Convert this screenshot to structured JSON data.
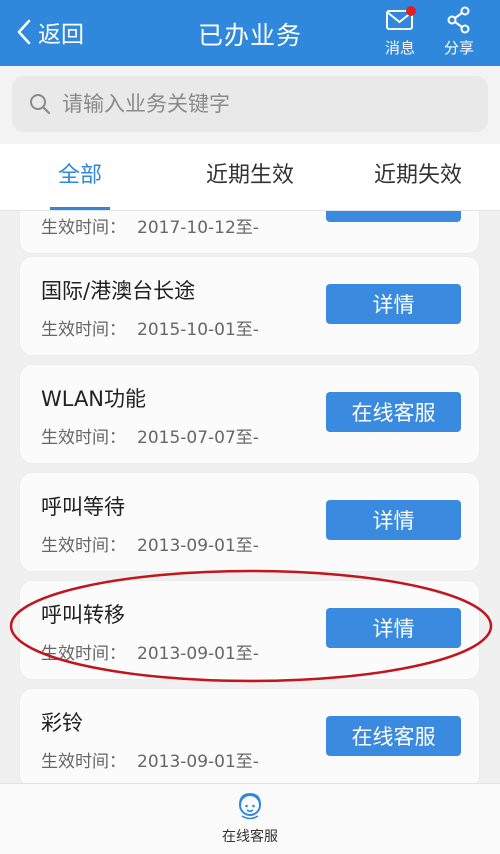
{
  "header": {
    "back_label": "返回",
    "title": "已办业务",
    "message_label": "消息",
    "share_label": "分享",
    "color": "#2f88db"
  },
  "search": {
    "placeholder": "请输入业务关键字"
  },
  "tabs": [
    {
      "label": "全部",
      "active": true
    },
    {
      "label": "近期生效",
      "active": false
    },
    {
      "label": "近期失效",
      "active": false
    }
  ],
  "date_prefix": "生效时间：",
  "items": [
    {
      "name": "",
      "date": "2017-10-12至-",
      "button": ""
    },
    {
      "name": "国际/港澳台长途",
      "date": "2015-10-01至-",
      "button": "详情"
    },
    {
      "name": "WLAN功能",
      "date": "2015-07-07至-",
      "button": "在线客服"
    },
    {
      "name": "呼叫等待",
      "date": "2013-09-01至-",
      "button": "详情"
    },
    {
      "name": "呼叫转移",
      "date": "2013-09-01至-",
      "button": "详情"
    },
    {
      "name": "彩铃",
      "date": "2013-09-01至-",
      "button": "在线客服"
    }
  ],
  "bottom": {
    "service_label": "在线客服",
    "service_icon": "customer-service-icon"
  },
  "highlight_color": "#c0161d"
}
